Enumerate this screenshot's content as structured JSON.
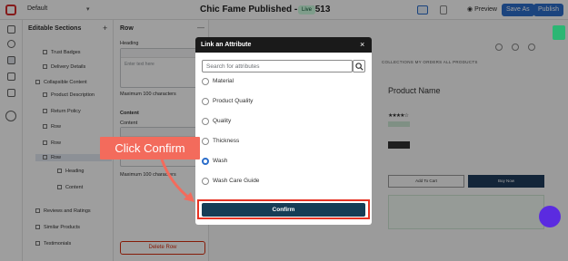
{
  "topbar": {
    "theme_name": "Default",
    "title": "Chic Fame Published - #89513",
    "live_badge": "Live",
    "preview_label": "Preview",
    "save_as_label": "Save As",
    "publish_label": "Publish"
  },
  "sections_panel": {
    "header": "Editable Sections",
    "items": [
      {
        "label": "Trust Badges"
      },
      {
        "label": "Delivery Details"
      },
      {
        "label": "Collapsible Content"
      },
      {
        "label": "Product Description"
      },
      {
        "label": "Return Policy"
      },
      {
        "label": "Row"
      },
      {
        "label": "Row"
      },
      {
        "label": "Row"
      },
      {
        "label": "Heading"
      },
      {
        "label": "Content"
      },
      {
        "label": "Reviews and Ratings"
      },
      {
        "label": "Similar Products"
      },
      {
        "label": "Testimonials"
      }
    ]
  },
  "row_panel": {
    "header": "Row",
    "heading_label": "Heading",
    "heading_placeholder": "Enter text here",
    "heading_max": "Maximum 100 characters",
    "content_section": "Content",
    "content_label": "Content",
    "content_max": "Maximum 100 characters",
    "delete_label": "Delete Row"
  },
  "store_preview": {
    "nav": "COLLECTIONS   MY ORDERS   ALL PRODUCTS",
    "product_name": "Product Name",
    "add_to_cart": "Add To Cart",
    "buy_now": "Buy Now"
  },
  "modal": {
    "title": "Link an Attribute",
    "search_placeholder": "Search for attributes",
    "options": [
      {
        "label": "Material",
        "checked": false
      },
      {
        "label": "Product Quality",
        "checked": false
      },
      {
        "label": "Quality",
        "checked": false
      },
      {
        "label": "Thickness",
        "checked": false
      },
      {
        "label": "Wash",
        "checked": true
      },
      {
        "label": "Wash Care Guide",
        "checked": false
      }
    ],
    "confirm_label": "Confirm"
  },
  "annotation": {
    "callout_text": "Click Confirm",
    "color": "#f36b5c"
  },
  "colors": {
    "primary": "#2c6ecb",
    "confirm": "#163d56",
    "highlight_box": "#e63324"
  }
}
